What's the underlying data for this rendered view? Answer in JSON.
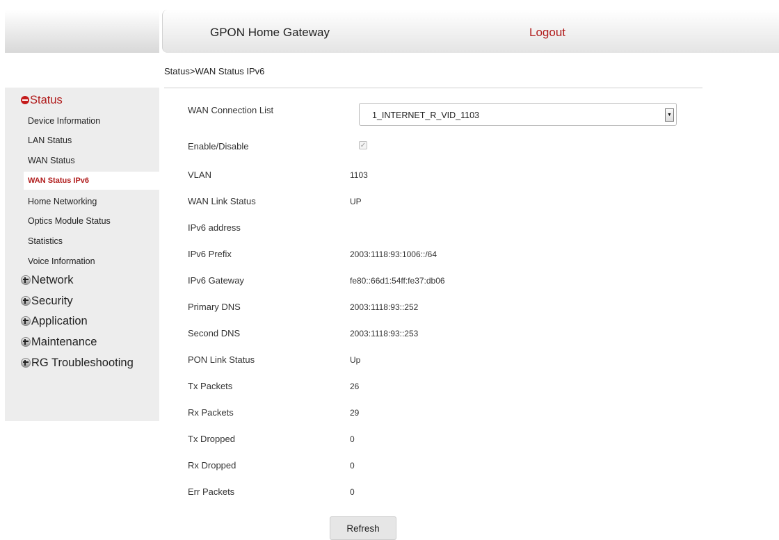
{
  "header": {
    "title": "GPON Home Gateway",
    "logout": "Logout"
  },
  "breadcrumb": "Status>WAN Status IPv6",
  "sidebar": {
    "status": "Status",
    "status_items": [
      "Device Information",
      "LAN Status",
      "WAN Status",
      "WAN Status IPv6",
      "Home Networking",
      "Optics Module Status",
      "Statistics",
      "Voice Information"
    ],
    "sections": [
      "Network",
      "Security",
      "Application",
      "Maintenance",
      "RG Troubleshooting"
    ]
  },
  "form": {
    "connection_label": "WAN Connection List",
    "connection_value": "1_INTERNET_R_VID_1103",
    "enable_label": "Enable/Disable",
    "enable_checked": true,
    "rows": [
      {
        "label": "VLAN",
        "value": "1103"
      },
      {
        "label": "WAN Link Status",
        "value": "UP"
      },
      {
        "label": "IPv6 address",
        "value": ""
      },
      {
        "label": "IPv6 Prefix",
        "value": "2003:1118:93:1006::/64"
      },
      {
        "label": "IPv6 Gateway",
        "value": "fe80::66d1:54ff:fe37:db06"
      },
      {
        "label": "Primary DNS",
        "value": "2003:1118:93::252"
      },
      {
        "label": "Second DNS",
        "value": "2003:1118:93::253"
      },
      {
        "label": "PON Link Status",
        "value": "Up"
      },
      {
        "label": "Tx Packets",
        "value": "26"
      },
      {
        "label": "Rx Packets",
        "value": "29"
      },
      {
        "label": "Tx Dropped",
        "value": "0"
      },
      {
        "label": "Rx Dropped",
        "value": "0"
      },
      {
        "label": "Err Packets",
        "value": "0"
      }
    ],
    "refresh": "Refresh"
  },
  "colors": {
    "accent": "#b01b1b",
    "sidebar_bg": "#ededed"
  }
}
